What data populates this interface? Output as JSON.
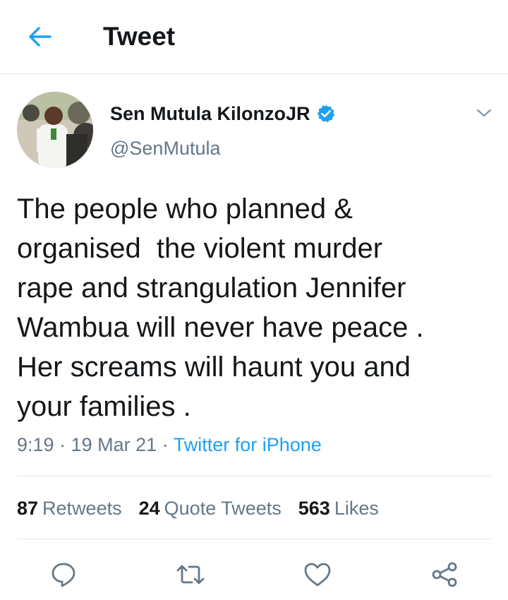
{
  "header": {
    "title": "Tweet",
    "back_icon": "arrow-left-icon",
    "accent": "#1da1f2"
  },
  "author": {
    "name": "Sen Mutula KilonzoJR",
    "handle": "@SenMutula",
    "verified": true,
    "verified_icon": "verified-badge-icon"
  },
  "tweet": {
    "text": "The people who planned &\norganised  the violent murder\nrape and strangulation Jennifer\nWambua will never have peace .\nHer screams will haunt you and\nyour families .",
    "time": "9:19",
    "date": "19 Mar 21",
    "separator": "·",
    "source": "Twitter for iPhone"
  },
  "stats": {
    "retweets_count": "87",
    "retweets_label": "Retweets",
    "quotes_count": "24",
    "quotes_label": "Quote Tweets",
    "likes_count": "563",
    "likes_label": "Likes"
  },
  "actions": {
    "reply_icon": "reply-icon",
    "retweet_icon": "retweet-icon",
    "like_icon": "heart-icon",
    "share_icon": "share-icon"
  },
  "colors": {
    "primary_text": "#14171a",
    "secondary_text": "#657786",
    "divider": "#e1e8ed",
    "link": "#1da1f2"
  }
}
